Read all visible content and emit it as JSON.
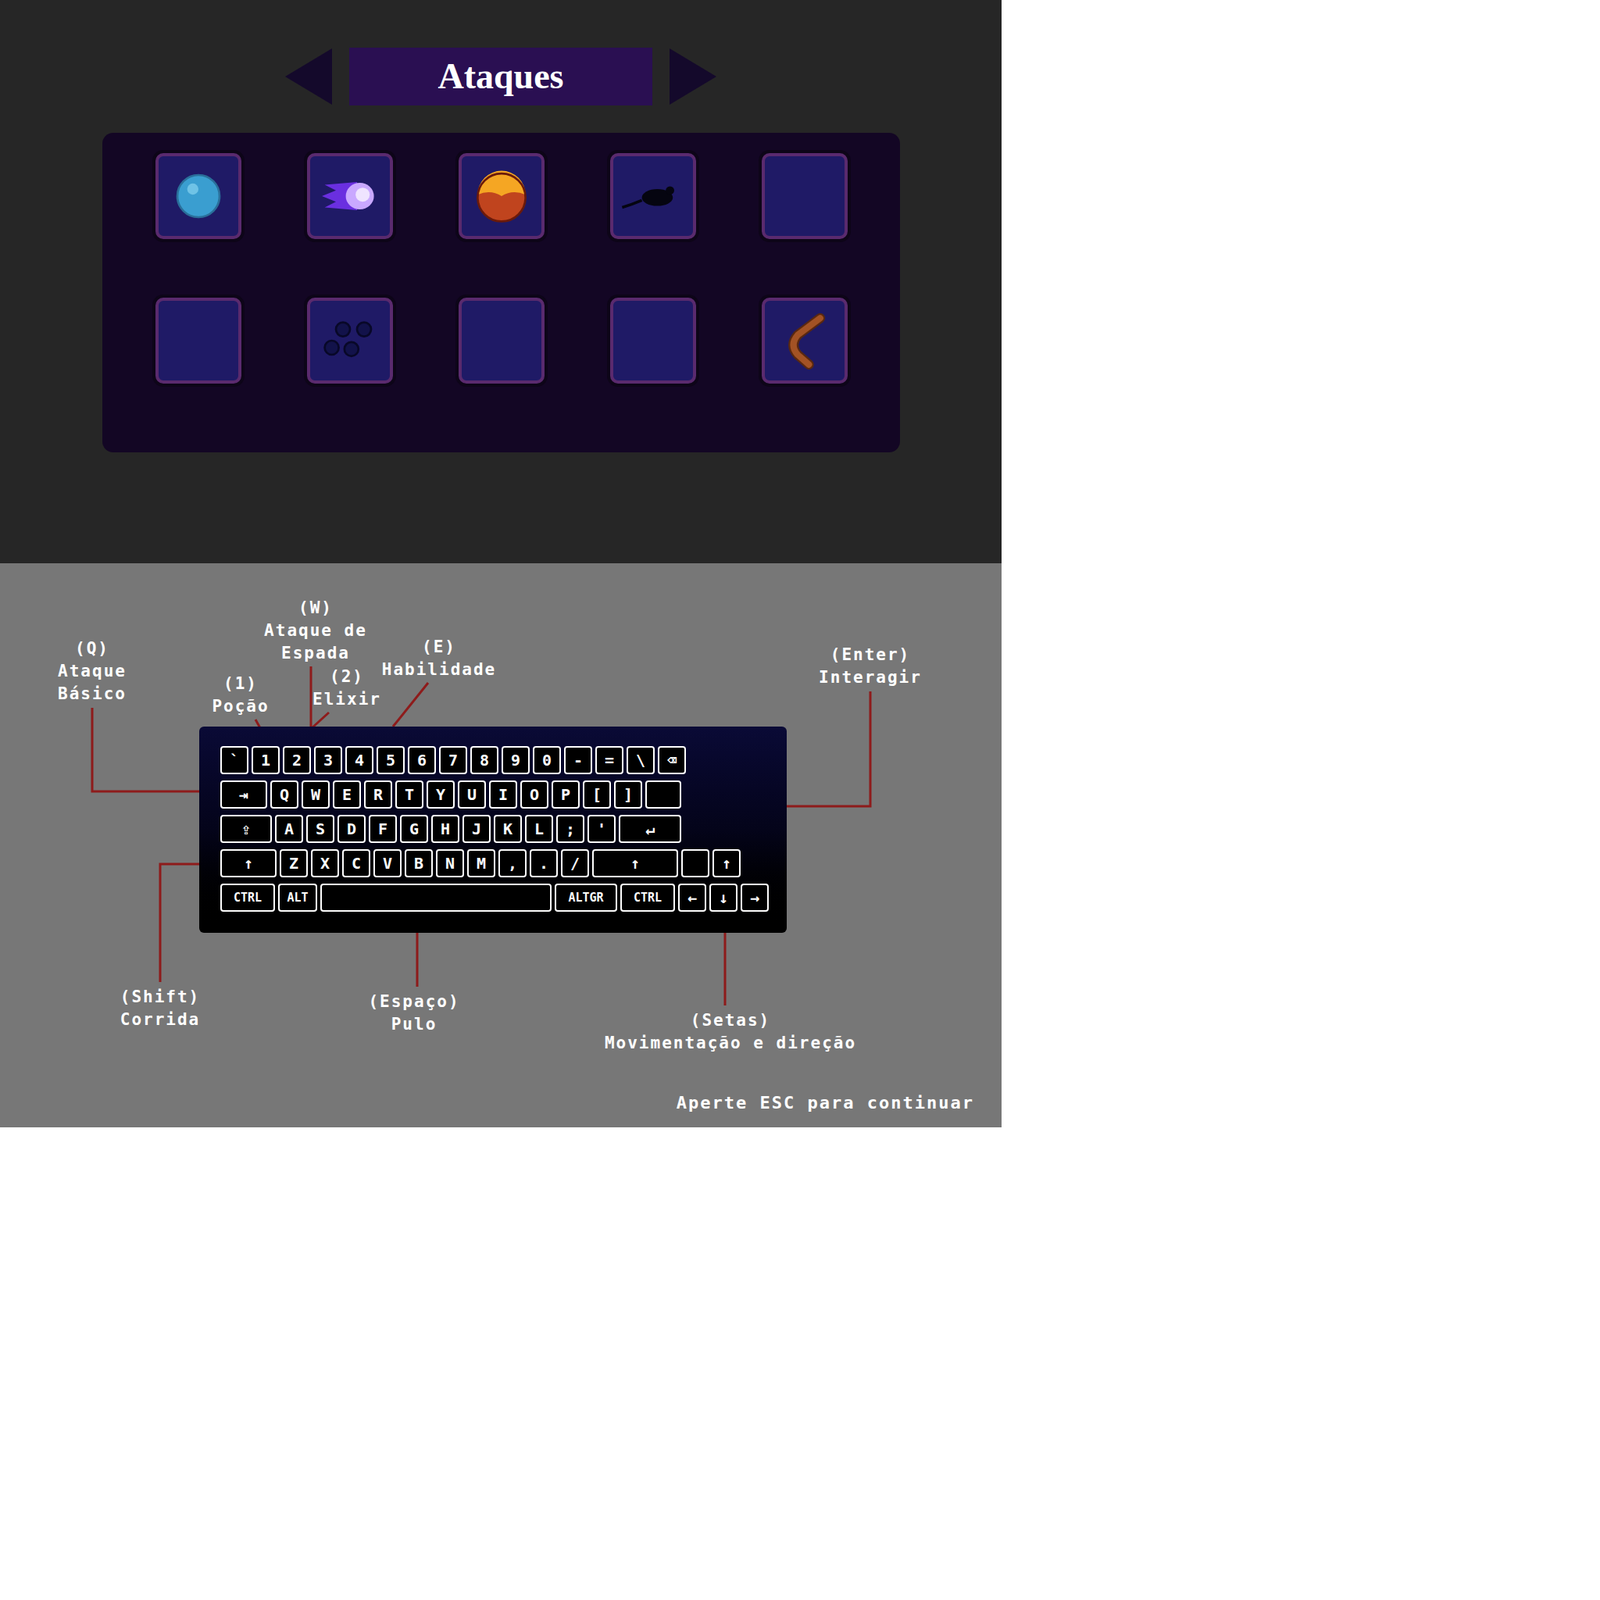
{
  "menu": {
    "title": "Ataques"
  },
  "slots": [
    {
      "kind": "orb"
    },
    {
      "kind": "comet"
    },
    {
      "kind": "fireball"
    },
    {
      "kind": "rat"
    },
    {
      "kind": "empty"
    },
    {
      "kind": "empty"
    },
    {
      "kind": "dots"
    },
    {
      "kind": "empty"
    },
    {
      "kind": "empty"
    },
    {
      "kind": "boomerang"
    }
  ],
  "keyboard": {
    "rows": [
      [
        {
          "label": "`",
          "kind": "key"
        },
        {
          "label": "1",
          "kind": "key"
        },
        {
          "label": "2",
          "kind": "key"
        },
        {
          "label": "3",
          "kind": "key"
        },
        {
          "label": "4",
          "kind": "key"
        },
        {
          "label": "5",
          "kind": "key"
        },
        {
          "label": "6",
          "kind": "key"
        },
        {
          "label": "7",
          "kind": "key"
        },
        {
          "label": "8",
          "kind": "key"
        },
        {
          "label": "9",
          "kind": "key"
        },
        {
          "label": "0",
          "kind": "key"
        },
        {
          "label": "-",
          "kind": "key"
        },
        {
          "label": "=",
          "kind": "key"
        },
        {
          "label": "\\",
          "kind": "key"
        },
        {
          "label": "⌫",
          "kind": "key"
        }
      ],
      [
        {
          "label": "⇥",
          "kind": "tab"
        },
        {
          "label": "Q",
          "kind": "key"
        },
        {
          "label": "W",
          "kind": "key"
        },
        {
          "label": "E",
          "kind": "key"
        },
        {
          "label": "R",
          "kind": "key"
        },
        {
          "label": "T",
          "kind": "key"
        },
        {
          "label": "Y",
          "kind": "key"
        },
        {
          "label": "U",
          "kind": "key"
        },
        {
          "label": "I",
          "kind": "key"
        },
        {
          "label": "O",
          "kind": "key"
        },
        {
          "label": "P",
          "kind": "key"
        },
        {
          "label": "[",
          "kind": "key"
        },
        {
          "label": "]",
          "kind": "key"
        },
        {
          "label": "",
          "kind": "enter-top"
        }
      ],
      [
        {
          "label": "⇪",
          "kind": "caps"
        },
        {
          "label": "A",
          "kind": "key"
        },
        {
          "label": "S",
          "kind": "key"
        },
        {
          "label": "D",
          "kind": "key"
        },
        {
          "label": "F",
          "kind": "key"
        },
        {
          "label": "G",
          "kind": "key"
        },
        {
          "label": "H",
          "kind": "key"
        },
        {
          "label": "J",
          "kind": "key"
        },
        {
          "label": "K",
          "kind": "key"
        },
        {
          "label": "L",
          "kind": "key"
        },
        {
          "label": ";",
          "kind": "key"
        },
        {
          "label": "'",
          "kind": "key"
        },
        {
          "label": "↵",
          "kind": "enter"
        }
      ],
      [
        {
          "label": "↑",
          "kind": "shift"
        },
        {
          "label": "Z",
          "kind": "key"
        },
        {
          "label": "X",
          "kind": "key"
        },
        {
          "label": "C",
          "kind": "key"
        },
        {
          "label": "V",
          "kind": "key"
        },
        {
          "label": "B",
          "kind": "key"
        },
        {
          "label": "N",
          "kind": "key"
        },
        {
          "label": "M",
          "kind": "key"
        },
        {
          "label": ",",
          "kind": "key"
        },
        {
          "label": ".",
          "kind": "key"
        },
        {
          "label": "/",
          "kind": "key"
        },
        {
          "label": "↑",
          "kind": "rshift"
        },
        {
          "label": "",
          "kind": "key"
        },
        {
          "label": "↑",
          "kind": "key"
        }
      ],
      [
        {
          "label": "CTRL",
          "kind": "ctrl"
        },
        {
          "label": "ALT",
          "kind": "alt"
        },
        {
          "label": "",
          "kind": "space"
        },
        {
          "label": "ALTGR",
          "kind": "altgr"
        },
        {
          "label": "CTRL",
          "kind": "ctrl"
        },
        {
          "label": "←",
          "kind": "key"
        },
        {
          "label": "↓",
          "kind": "key"
        },
        {
          "label": "→",
          "kind": "key"
        }
      ]
    ]
  },
  "annotations": [
    {
      "lines": [
        "(Q)",
        "Ataque",
        "Básico"
      ]
    },
    {
      "lines": [
        "(1)",
        "Poção"
      ]
    },
    {
      "lines": [
        "(W)",
        "Ataque de",
        "Espada"
      ]
    },
    {
      "lines": [
        "(2)",
        "Elixir"
      ]
    },
    {
      "lines": [
        "(E)",
        "Habilidade"
      ]
    },
    {
      "lines": [
        "(Enter)",
        "Interagir"
      ]
    },
    {
      "lines": [
        "(Shift)",
        "Corrida"
      ]
    },
    {
      "lines": [
        "(Espaço)",
        "Pulo"
      ]
    },
    {
      "lines": [
        "(Setas)",
        "Movimentação e direção"
      ]
    }
  ],
  "hint": "Aperte ESC para continuar"
}
